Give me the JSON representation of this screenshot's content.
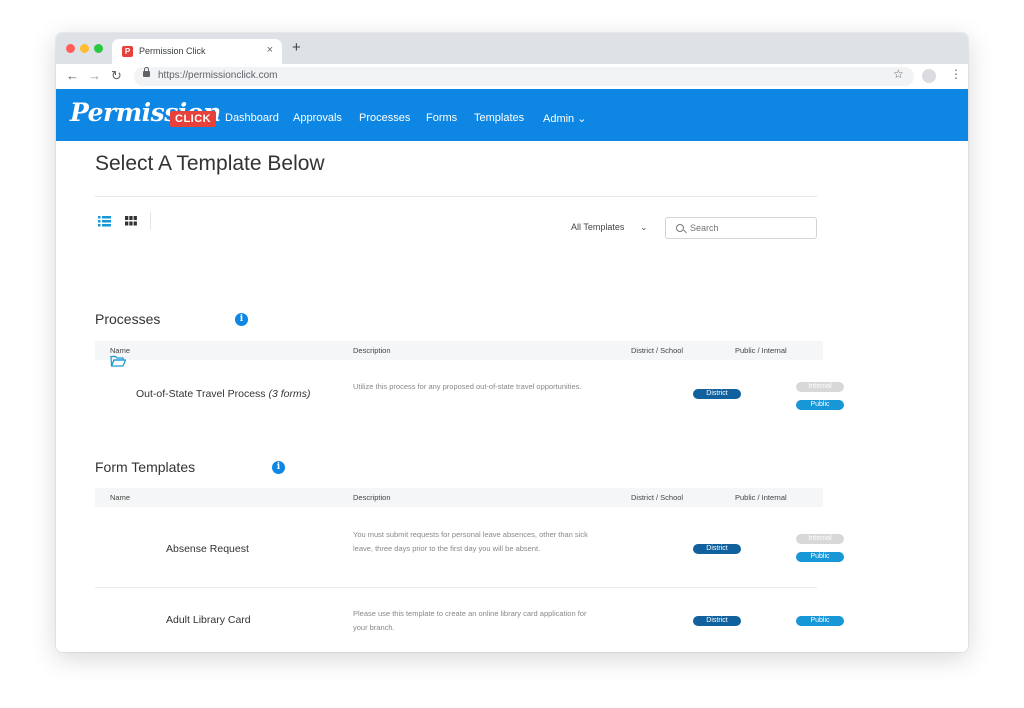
{
  "browser": {
    "tab_title": "Permission Click",
    "tab_close": "×",
    "new_tab": "+",
    "url": "https://permissionclick.com",
    "back": "←",
    "forward": "→",
    "reload": "↻",
    "star": "☆",
    "menu": "⋮"
  },
  "app": {
    "logo_text": "Permission",
    "logo_badge": "CLICK",
    "nav": [
      "Dashboard",
      "Approvals",
      "Processes",
      "Forms",
      "Templates",
      "Admin ⌄"
    ]
  },
  "page": {
    "title": "Select A Template Below",
    "filter_label": "All Templates",
    "filter_chevron": "⌄",
    "search_placeholder": "Search"
  },
  "columns": {
    "name": "Name",
    "description": "Description",
    "district_school": "District / School",
    "public_internal": "Public / Internal"
  },
  "processes": {
    "heading": "Processes",
    "info": "i",
    "rows": [
      {
        "name": "Out-of-State Travel Process",
        "name_suffix": "(3 forms)",
        "description": "Utilize this process for any proposed out-of-state travel opportunities.",
        "scope": "District",
        "visibility": [
          "Internal",
          "Public"
        ]
      }
    ]
  },
  "form_templates": {
    "heading": "Form Templates",
    "info": "i",
    "rows": [
      {
        "name": "Absense Request",
        "description": "You must submit requests for personal leave absences, other than sick leave, three days prior to the first day you will be absent.",
        "scope": "District",
        "visibility": [
          "Internal",
          "Public"
        ]
      },
      {
        "name": "Adult Library Card",
        "description": "Please use this template to create an online library card application for your branch.",
        "scope": "District",
        "visibility": [
          "Public"
        ]
      }
    ]
  },
  "icons": {
    "list_view": "list-icon",
    "grid_view": "grid-icon",
    "search": "search-icon",
    "folder": "folder-icon",
    "info": "info-icon"
  },
  "colors": {
    "brand_blue": "#0e86e3",
    "brand_red": "#e8413c",
    "district_badge": "#10619e",
    "public_badge": "#1797d6",
    "internal_badge": "#d8d8d8"
  }
}
